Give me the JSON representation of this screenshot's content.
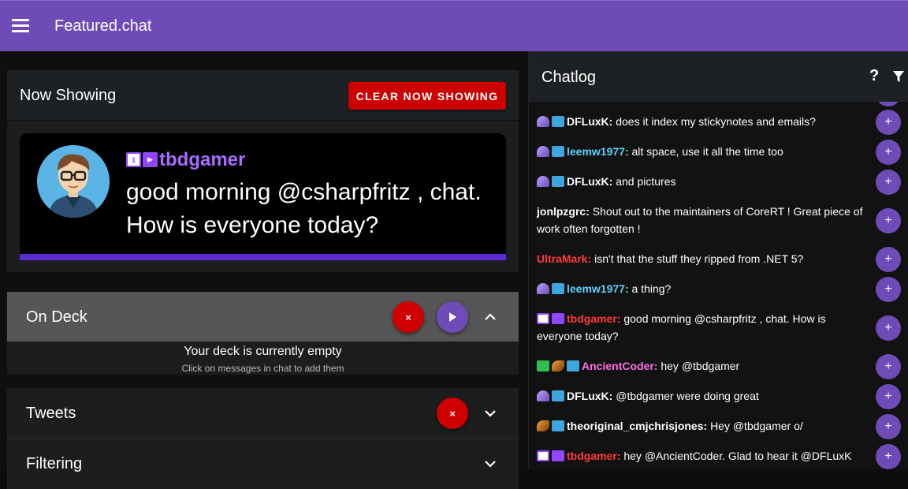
{
  "app": {
    "title": "Featured.chat"
  },
  "now_showing": {
    "title": "Now Showing",
    "clear_label": "CLEAR NOW SHOWING",
    "username": "tbdgamer",
    "message": "good morning @csharpfritz , chat. How is everyone today?"
  },
  "on_deck": {
    "title": "On Deck",
    "remove_icon": "×",
    "empty_title": "Your deck is currently empty",
    "empty_subtitle": "Click on messages in chat to add them"
  },
  "tweets": {
    "title": "Tweets",
    "remove_icon": "×"
  },
  "filtering": {
    "title": "Filtering"
  },
  "chatlog": {
    "title": "Chatlog",
    "help_label": "?",
    "add_label": "+",
    "messages": [
      {
        "user": "DFLuxK",
        "text": "does it index my stickynotes and emails?",
        "color": "#ffffff"
      },
      {
        "user": "leemw1977",
        "text": "alt space, use it all the time too",
        "color": "#5fd3ff"
      },
      {
        "user": "DFLuxK",
        "text": "and pictures",
        "color": "#ffffff"
      },
      {
        "user": "jonlpzgrc",
        "text": "Shout out to the maintainers of CoreRT ! Great piece of work often forgotten !",
        "color": "#ffffff"
      },
      {
        "user": "UltraMark",
        "text": "isn't that the stuff they ripped from .NET 5?",
        "color": "#ff3b3b"
      },
      {
        "user": "leemw1977",
        "text": "a thing?",
        "color": "#5fd3ff"
      },
      {
        "user": "tbdgamer",
        "text": "good morning @csharpfritz , chat. How is everyone today?",
        "color": "#ff3b3b"
      },
      {
        "user": "AncientCoder",
        "text": "hey @tbdgamer",
        "color": "#ff6ee8"
      },
      {
        "user": "DFLuxK",
        "text": "@tbdgamer were doing great",
        "color": "#ffffff"
      },
      {
        "user": "theoriginal_cmjchrisjones",
        "text": "Hey @tbdgamer o/",
        "color": "#ffffff"
      },
      {
        "user": "tbdgamer",
        "text": "hey @AncientCoder. Glad to hear it @DFLuxK",
        "color": "#ff3b3b"
      }
    ]
  }
}
